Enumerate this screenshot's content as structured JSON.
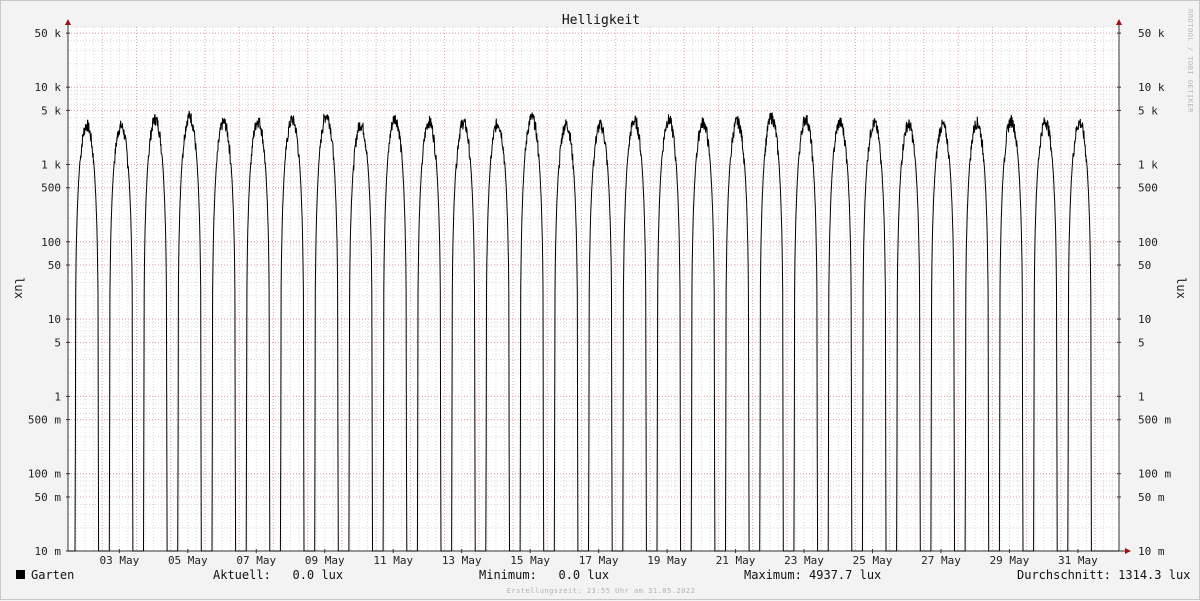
{
  "chart_data": {
    "type": "line",
    "title": "Helligkeit",
    "ylabel": "lux",
    "yscale": "log",
    "ylim": [
      0.01,
      60000
    ],
    "xlim": [
      0,
      30.7
    ],
    "y_ticks": [
      {
        "v": 50000,
        "label": "50 k"
      },
      {
        "v": 10000,
        "label": "10 k"
      },
      {
        "v": 5000,
        "label": "5 k"
      },
      {
        "v": 1000,
        "label": "1 k"
      },
      {
        "v": 500,
        "label": "500"
      },
      {
        "v": 100,
        "label": "100"
      },
      {
        "v": 50,
        "label": "50"
      },
      {
        "v": 10,
        "label": "10"
      },
      {
        "v": 5,
        "label": "5"
      },
      {
        "v": 1,
        "label": "1"
      },
      {
        "v": 0.5,
        "label": "500 m"
      },
      {
        "v": 0.1,
        "label": "100 m"
      },
      {
        "v": 0.05,
        "label": "50 m"
      },
      {
        "v": 0.01,
        "label": "10 m"
      }
    ],
    "x_ticks": [
      {
        "d": 1.5,
        "label": "03 May"
      },
      {
        "d": 3.5,
        "label": "05 May"
      },
      {
        "d": 5.5,
        "label": "07 May"
      },
      {
        "d": 7.5,
        "label": "09 May"
      },
      {
        "d": 9.5,
        "label": "11 May"
      },
      {
        "d": 11.5,
        "label": "13 May"
      },
      {
        "d": 13.5,
        "label": "15 May"
      },
      {
        "d": 15.5,
        "label": "17 May"
      },
      {
        "d": 17.5,
        "label": "19 May"
      },
      {
        "d": 19.5,
        "label": "21 May"
      },
      {
        "d": 21.5,
        "label": "23 May"
      },
      {
        "d": 23.5,
        "label": "25 May"
      },
      {
        "d": 25.5,
        "label": "27 May"
      },
      {
        "d": 27.5,
        "label": "29 May"
      },
      {
        "d": 29.5,
        "label": "31 May"
      }
    ],
    "series": [
      {
        "name": "Garten",
        "color": "#000000",
        "daily_peaks_lux": [
          3500,
          3400,
          4200,
          4600,
          3800,
          4000,
          4100,
          4700,
          3600,
          4300,
          3900,
          3800,
          3700,
          4400,
          3600,
          3500,
          4000,
          4100,
          3800,
          3900,
          4400,
          4200,
          3800,
          3700,
          3600,
          3500,
          3800,
          4000,
          3900,
          3800
        ]
      }
    ],
    "grid": true,
    "legend": "bottom-left"
  },
  "legend": {
    "series_name": "Garten",
    "aktuell": "Aktuell:   0.0 lux",
    "minimum": "Minimum:   0.0 lux",
    "maximum": "Maximum: 4937.7 lux",
    "durchschnitt": "Durchschnitt: 1314.3 lux"
  },
  "watermark": "RRDTOOL / TOBI OETIKER",
  "footer": "Erstellungszeit: 23:55 Uhr am 31.05.2022",
  "colors": {
    "background": "#f3f3f3",
    "plot_background": "#ffffff",
    "major_grid": "#e8a0a0",
    "minor_grid": "#d8d8d8",
    "line": "#000000",
    "arrow": "#a01010"
  }
}
